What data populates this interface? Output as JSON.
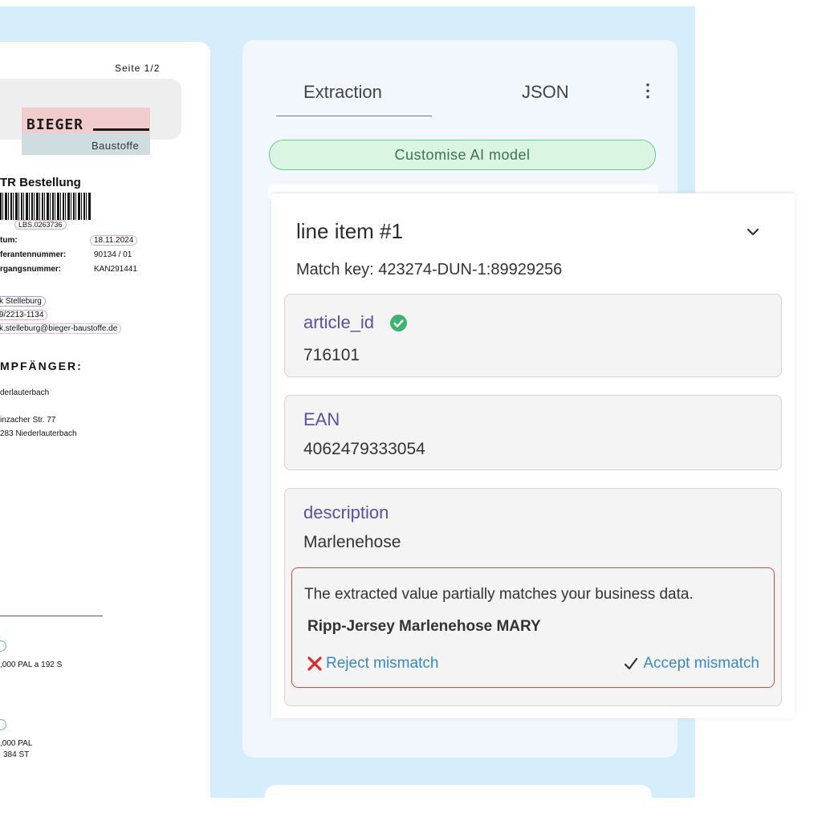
{
  "document": {
    "page_indicator": "Seite 1/2",
    "logo": {
      "brand": "BIEGER",
      "subtitle": "Baustoffe"
    },
    "order_title": "TR Bestellung",
    "barcode_number": "LBS.0263736",
    "fields": [
      {
        "label": "tum:",
        "value": "18.11.2024"
      },
      {
        "label": "ferantennummer:",
        "value": "90134 / 01"
      },
      {
        "label": "rgangsnummer:",
        "value": "KAN291441"
      }
    ],
    "contact": {
      "name": "k Stelleburg",
      "phone": "9/2213-1134",
      "email": "k.stelleburg@bieger-baustoffe.de"
    },
    "recipient_heading": "MPFÄNGER:",
    "recipient": {
      "line1": "derlauterbach",
      "line2": "inzacher Str. 77",
      "line3": "283 Niederlauterbach"
    },
    "items": [
      {
        "line1": ",000 PAL  a 192 S"
      },
      {
        "line1": ",000 PAL",
        "line2": "384 ST"
      }
    ]
  },
  "panel": {
    "tabs": [
      {
        "label": "Extraction",
        "active": true
      },
      {
        "label": "JSON",
        "active": false
      }
    ],
    "menu_icon": "kebab-menu-icon",
    "customise_label": "Customise AI model"
  },
  "line_item": {
    "title": "line item #1",
    "match_key": "Match key: 423274-DUN-1:89929256",
    "fields": [
      {
        "label": "article_id",
        "value": "716101",
        "verified": true
      },
      {
        "label": "EAN",
        "value": "4062479333054"
      },
      {
        "label": "description",
        "value": "Marlenehose"
      }
    ],
    "mismatch": {
      "message": "The extracted value partially matches your business data.",
      "suggestion": "Ripp-Jersey Marlenehose MARY",
      "reject_label": "Reject mismatch",
      "accept_label": "Accept mismatch"
    }
  },
  "colors": {
    "accent_purple": "#5a4fa3",
    "link_blue": "#3a87c7",
    "error_red": "#d14a4a",
    "success_green": "#3cb371",
    "backdrop_blue": "#d6edfb"
  }
}
